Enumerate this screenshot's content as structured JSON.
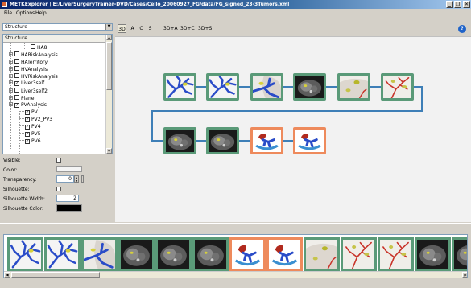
{
  "window": {
    "title": "METKExplorer | E:/LiverSurgeryTrainer-DVD/Cases/Cello_20060927_FG/data/FG_signed_23-3Tumors.xml",
    "minimize_glyph": "_",
    "restore_glyph": "❐",
    "close_glyph": "✕"
  },
  "menu": {
    "file": "File",
    "options": "Options",
    "help": "Help"
  },
  "structure_combo": {
    "value": "Structure"
  },
  "tree": {
    "header": "Structure",
    "nodes": [
      {
        "label": "HA8",
        "checked": false
      },
      {
        "label": "HARiskAnalysis",
        "checked": false
      },
      {
        "label": "HATerritory",
        "checked": false
      },
      {
        "label": "HVAnalysis",
        "checked": false
      },
      {
        "label": "HVRiskAnalysis",
        "checked": false
      },
      {
        "label": "Liver3self",
        "checked": true
      },
      {
        "label": "Liver3self2",
        "checked": false
      },
      {
        "label": "Plane",
        "checked": false
      },
      {
        "label": "PVAnalysis",
        "checked": true
      },
      {
        "label": "PV",
        "checked": true
      },
      {
        "label": "PV2_PV3",
        "checked": true
      },
      {
        "label": "PV4",
        "checked": true
      },
      {
        "label": "PV5",
        "checked": true
      },
      {
        "label": "PV6",
        "checked": true
      }
    ]
  },
  "properties": {
    "visible_label": "Visible:",
    "color_label": "Color:",
    "transparency_label": "Transparency:",
    "transparency_value": "0",
    "silhouette_label": "Silhouette:",
    "silhouette_width_label": "Silhouette Width:",
    "silhouette_width_value": "2",
    "silhouette_color_label": "Silhouette Color:",
    "color_swatch": "#f4f4f4",
    "silhouette_swatch": "#000000"
  },
  "view_buttons": [
    "3D",
    "A",
    "C",
    "S",
    "3D+A",
    "3D+C",
    "3D+S"
  ],
  "active_view": "3D",
  "help_glyph": "?",
  "colors": {
    "node_green": "#5a9a78",
    "node_orange": "#ee8a5c",
    "connector_blue": "#3e7fb7",
    "vessel_blue": "#2a4cc8",
    "vessel_red": "#c8342a"
  },
  "workflow_nodes": [
    {
      "kind": "portal-vein-icon",
      "frame": "green"
    },
    {
      "kind": "portal-vein-icon",
      "frame": "green"
    },
    {
      "kind": "vessel-with-liver-icon",
      "frame": "green"
    },
    {
      "kind": "ct-slice-icon",
      "frame": "green"
    },
    {
      "kind": "liver-tumor-icon",
      "frame": "green"
    },
    {
      "kind": "hepatic-artery-icon",
      "frame": "green"
    },
    {
      "kind": "ct-slice-icon",
      "frame": "green"
    },
    {
      "kind": "ct-slice-icon",
      "frame": "green"
    },
    {
      "kind": "rotating-vessel-icon",
      "frame": "orange"
    },
    {
      "kind": "rotating-vessel-icon",
      "frame": "orange"
    }
  ],
  "filmstrip": [
    {
      "kind": "portal-vein-icon",
      "frame": "green"
    },
    {
      "kind": "portal-vein-icon",
      "frame": "green"
    },
    {
      "kind": "vessel-with-liver-icon",
      "frame": "green"
    },
    {
      "kind": "ct-slice-icon",
      "frame": "green"
    },
    {
      "kind": "ct-slice-icon",
      "frame": "green"
    },
    {
      "kind": "ct-slice-icon",
      "frame": "green"
    },
    {
      "kind": "rotating-vessel-icon",
      "frame": "orange"
    },
    {
      "kind": "rotating-vessel-icon",
      "frame": "orange"
    },
    {
      "kind": "liver-tumor-icon",
      "frame": "green"
    },
    {
      "kind": "hepatic-artery-icon",
      "frame": "green"
    },
    {
      "kind": "hepatic-artery-icon",
      "frame": "green"
    },
    {
      "kind": "ct-slice-icon",
      "frame": "green"
    },
    {
      "kind": "ct-slice-icon",
      "frame": "green"
    }
  ]
}
